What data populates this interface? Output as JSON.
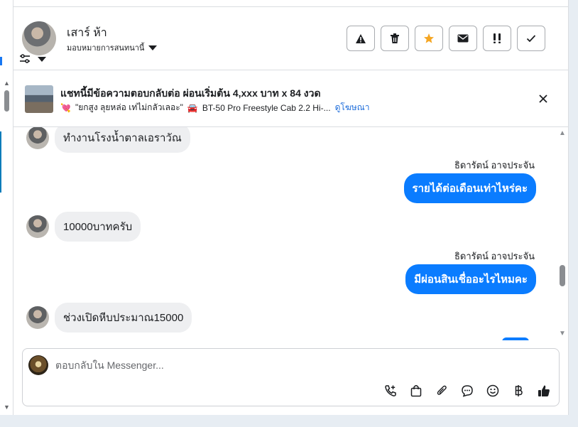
{
  "contact": {
    "name": "เสาร์ ห้า",
    "assign_label": "มอบหมายการสนทนานี้"
  },
  "header_actions": [
    {
      "name": "report-spam-button",
      "icon": "warning-icon"
    },
    {
      "name": "delete-button",
      "icon": "trash-icon"
    },
    {
      "name": "star-button",
      "icon": "star-icon"
    },
    {
      "name": "mark-unread-button",
      "icon": "envelope-icon"
    },
    {
      "name": "priority-button",
      "icon": "double-exclamation-icon"
    },
    {
      "name": "mark-done-button",
      "icon": "checkmark-icon"
    }
  ],
  "ad": {
    "title": "แชทนี้มีข้อความตอบกลับต่อ ผ่อนเริ่มต้น 4,xxx บาท x 84 งวด",
    "quote": "\"ยกสูง ลุยหล่อ เท่ไม่กลัวเลอะ\"",
    "product": "BT-50 Pro Freestyle Cab 2.2 Hi-...",
    "link_label": "ดูโฆษณา"
  },
  "messages": {
    "m1": "ทำงานโรงน้ำตาลเอราวัณ",
    "s1": "ธิดารัตน์ อาจประจัน",
    "m2": "รายได้ต่อเดือนเท่าไหร่คะ",
    "m3": "10000บาทครับ",
    "s2": "ธิดารัตน์ อาจประจัน",
    "m4": "มีผ่อนสินเชื่ออะไรไหมคะ",
    "m5": "ช่วงเปิดหีบประมาณ15000"
  },
  "composer": {
    "placeholder": "ตอบกลับใน Messenger..."
  },
  "colors": {
    "accent": "#0a7cff",
    "star": "#f5a623",
    "link": "#216fdb"
  }
}
